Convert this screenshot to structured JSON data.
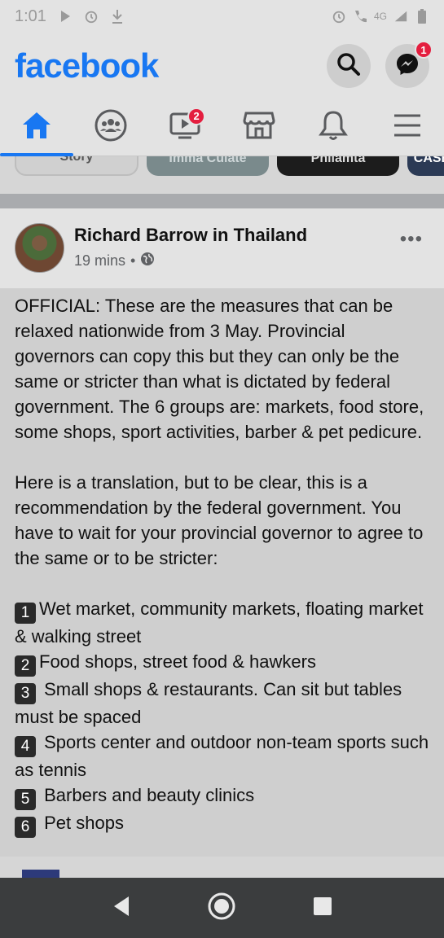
{
  "status_bar": {
    "time": "1:01",
    "network": "4G"
  },
  "header": {
    "logo": "facebook",
    "messenger_badge": "1"
  },
  "nav": {
    "tabs": [
      {
        "name": "home",
        "active": true
      },
      {
        "name": "groups"
      },
      {
        "name": "watch",
        "badge": "2"
      },
      {
        "name": "marketplace"
      },
      {
        "name": "notifications"
      },
      {
        "name": "menu"
      }
    ]
  },
  "stories": {
    "chips": [
      "Story",
      "Imma Culate",
      "Philamta",
      "CASE"
    ]
  },
  "post": {
    "author": "Richard Barrow in Thailand",
    "time": "19 mins",
    "separator": "•",
    "paragraph1": "OFFICIAL: These are the measures that can be relaxed nationwide from 3 May. Provincial governors can copy this but they can only be the same or stricter than what is dictated by federal government. The 6 groups are: markets, food store, some shops, sport activities, barber & pet pedicure.",
    "paragraph2": "Here is a translation, but to be clear, this is a recommendation by the federal government. You have to wait for your provincial governor to agree to the same or to be stricter:",
    "items": [
      {
        "num": "1",
        "text": "Wet market, community markets, floating market & walking street"
      },
      {
        "num": "2",
        "text": "Food shops, street food & hawkers"
      },
      {
        "num": "3",
        "text": " Small shops & restaurants. Can sit but tables must be spaced"
      },
      {
        "num": "4",
        "text": " Sports center and outdoor non-team sports such as tennis"
      },
      {
        "num": "5",
        "text": " Barbers and beauty clinics"
      },
      {
        "num": "6",
        "text": " Pet shops"
      }
    ]
  },
  "colors": {
    "brand": "#1877f2",
    "badge": "#e41e3f"
  }
}
